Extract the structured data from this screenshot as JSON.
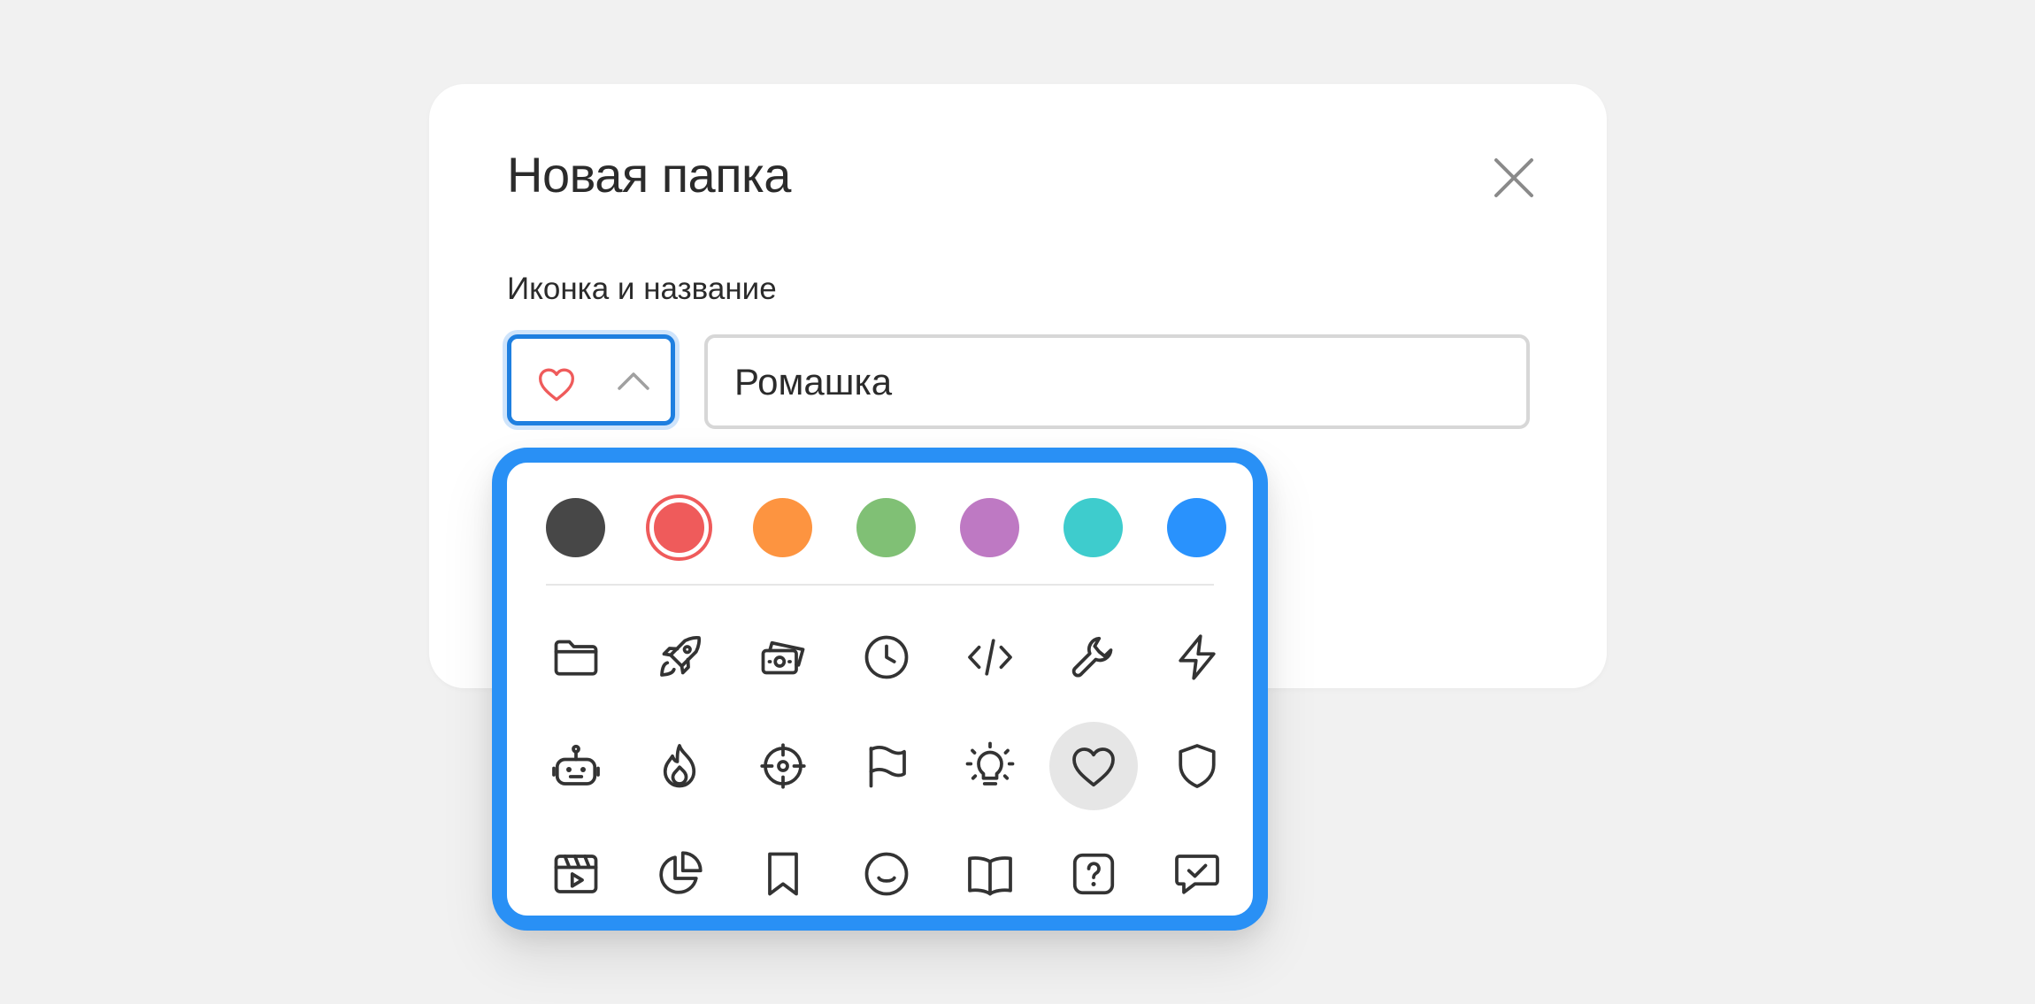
{
  "dialog": {
    "title": "Новая папка",
    "close_icon": "close-icon",
    "field_label": "Иконка и название",
    "selected_icon": "heart-icon",
    "selected_color": "#ef5b5b",
    "name_input_value": "Ромашка"
  },
  "picker": {
    "colors": [
      {
        "name": "dark-gray",
        "hex": "#474747",
        "selected": false
      },
      {
        "name": "red",
        "hex": "#ef5b5b",
        "selected": true
      },
      {
        "name": "orange",
        "hex": "#fd9440",
        "selected": false
      },
      {
        "name": "green",
        "hex": "#80c075",
        "selected": false
      },
      {
        "name": "purple",
        "hex": "#be79c3",
        "selected": false
      },
      {
        "name": "teal",
        "hex": "#3ecccd",
        "selected": false
      },
      {
        "name": "blue",
        "hex": "#2992fd",
        "selected": false
      }
    ],
    "icons": [
      "folder-icon",
      "rocket-icon",
      "money-icon",
      "clock-icon",
      "code-icon",
      "wrench-icon",
      "lightning-icon",
      "robot-icon",
      "fire-icon",
      "target-icon",
      "flag-icon",
      "lightbulb-icon",
      "heart-icon",
      "shield-icon",
      "clapperboard-icon",
      "pie-chart-icon",
      "bookmark-icon",
      "smile-icon",
      "book-icon",
      "question-icon",
      "chat-check-icon"
    ],
    "selected_icon_index": 12
  },
  "colors": {
    "accent": "#1e7fe0",
    "picker_border": "#2990f5",
    "text": "#2b2b2b",
    "icon_stroke": "#333333"
  }
}
